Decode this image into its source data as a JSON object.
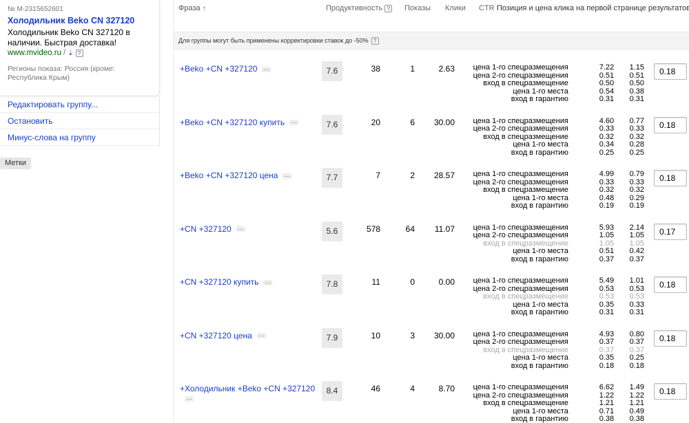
{
  "ad": {
    "number": "№ M-2315652601",
    "title": "Холодильник Beko CN 327120",
    "text": "Холодильник Beko CN 327120 в наличии. Быстрая доставка!",
    "url": "www.mvideo.ru",
    "url_sep": "/",
    "help_mark": "?",
    "regions": "Регионы показа: Россия (кроме: Республика Крым)"
  },
  "menu": {
    "items": [
      {
        "label": "Редактировать группу..."
      },
      {
        "label": "Остановить"
      },
      {
        "label": "Минус-слова на группу"
      }
    ]
  },
  "labels_tag": "Метки",
  "table": {
    "headers": {
      "phrase": "Фраза",
      "phrase_sort_icon": "arrow-up-icon",
      "productivity": "Продуктивность",
      "shows": "Показы",
      "clicks": "Клики",
      "ctr": "CTR",
      "position": "Позиция и цена клика на первой странице результатов поиска / списываемая цена, у.е."
    },
    "banner": "Для группы могут быть применены корректировки ставок до -50%",
    "bid_labels": [
      "цена 1-го спецразмещения",
      "цена 2-го спецразмещения",
      "вход в спецразмещение",
      "цена 1-го места",
      "вход в гарантию"
    ],
    "rows": [
      {
        "phrase": "+Beko +CN +327120",
        "productivity": "7.6",
        "shows": "38",
        "clicks": "1",
        "ctr": "2.63",
        "bid_value": "0.18",
        "bids": [
          [
            "7.22",
            "1.15"
          ],
          [
            "0.51",
            "0.51"
          ],
          [
            "0.50",
            "0.50"
          ],
          [
            "0.54",
            "0.38"
          ],
          [
            "0.31",
            "0.31"
          ]
        ],
        "disabled": []
      },
      {
        "phrase": "+Beko +CN +327120 купить",
        "productivity": "7.6",
        "shows": "20",
        "clicks": "6",
        "ctr": "30.00",
        "bid_value": "0.18",
        "bids": [
          [
            "4.60",
            "0.77"
          ],
          [
            "0.33",
            "0.33"
          ],
          [
            "0.32",
            "0.32"
          ],
          [
            "0.34",
            "0.28"
          ],
          [
            "0.25",
            "0.25"
          ]
        ],
        "disabled": []
      },
      {
        "phrase": "+Beko +CN +327120 цена",
        "productivity": "7.7",
        "shows": "7",
        "clicks": "2",
        "ctr": "28.57",
        "bid_value": "0.18",
        "bids": [
          [
            "4.99",
            "0.79"
          ],
          [
            "0.33",
            "0.33"
          ],
          [
            "0.32",
            "0.32"
          ],
          [
            "0.48",
            "0.29"
          ],
          [
            "0.19",
            "0.19"
          ]
        ],
        "disabled": []
      },
      {
        "phrase": "+CN +327120",
        "productivity": "5.6",
        "shows": "578",
        "clicks": "64",
        "ctr": "11.07",
        "bid_value": "0.17",
        "bids": [
          [
            "5.93",
            "2.14"
          ],
          [
            "1.05",
            "1.05"
          ],
          [
            "1.05",
            "1.05"
          ],
          [
            "0.51",
            "0.42"
          ],
          [
            "0.37",
            "0.37"
          ]
        ],
        "disabled": [
          2
        ]
      },
      {
        "phrase": "+CN +327120 купить",
        "productivity": "7.8",
        "shows": "11",
        "clicks": "0",
        "ctr": "0.00",
        "bid_value": "0.18",
        "bids": [
          [
            "5.49",
            "1.01"
          ],
          [
            "0.53",
            "0.53"
          ],
          [
            "0.53",
            "0.53"
          ],
          [
            "0.35",
            "0.33"
          ],
          [
            "0.31",
            "0.31"
          ]
        ],
        "disabled": [
          2
        ]
      },
      {
        "phrase": "+CN +327120 цена",
        "productivity": "7.9",
        "shows": "10",
        "clicks": "3",
        "ctr": "30.00",
        "bid_value": "0.18",
        "bids": [
          [
            "4.93",
            "0.80"
          ],
          [
            "0.37",
            "0.37"
          ],
          [
            "0.37",
            "0.37"
          ],
          [
            "0.35",
            "0.25"
          ],
          [
            "0.18",
            "0.18"
          ]
        ],
        "disabled": [
          2
        ]
      },
      {
        "phrase": "+Холодильник +Beko +CN +327120",
        "productivity": "8.4",
        "shows": "46",
        "clicks": "4",
        "ctr": "8.70",
        "bid_value": "0.18",
        "bids": [
          [
            "6.62",
            "1.49"
          ],
          [
            "1.22",
            "1.22"
          ],
          [
            "1.21",
            "1.21"
          ],
          [
            "0.71",
            "0.49"
          ],
          [
            "0.38",
            "0.38"
          ]
        ],
        "disabled": []
      }
    ]
  },
  "more_dots": "···",
  "colors": {
    "link": "#1a3dc1",
    "url": "#006000",
    "muted": "#777777",
    "disabled": "#aaaaaa"
  }
}
